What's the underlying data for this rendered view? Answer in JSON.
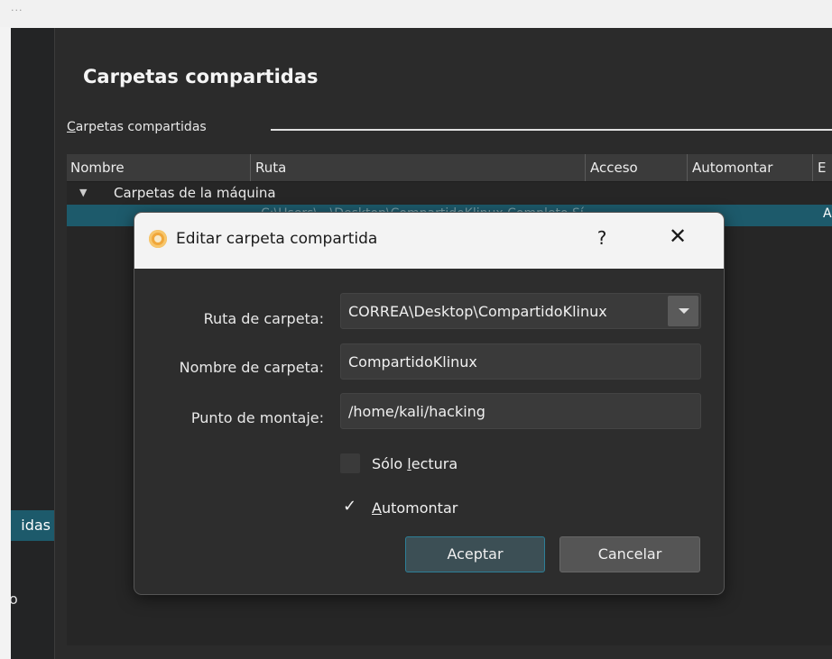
{
  "top_strip": {
    "glyph": "..."
  },
  "sidebar": {
    "items": [
      {
        "label": "idas",
        "active": true
      },
      {
        "label": "o",
        "active": false
      }
    ]
  },
  "page": {
    "title": "Carpetas compartidas",
    "group_label_accel": "C",
    "group_label_rest": "arpetas compartidas"
  },
  "table": {
    "columns": [
      "Nombre",
      "Ruta",
      "Acceso",
      "Automontar",
      "E"
    ],
    "tree_group": "Carpetas de la máquina",
    "selected_row_ghost": "C:\\Users\\...\\Desktop\\CompartidoKlinux   Completo   Sí",
    "selected_row_tail": "A"
  },
  "dialog": {
    "title": "Editar carpeta compartida",
    "help_glyph": "?",
    "close_glyph": "✕",
    "fields": {
      "path_label": "Ruta de carpeta:",
      "path_value": "CORREA\\Desktop\\CompartidoKlinux",
      "name_label": "Nombre de carpeta:",
      "name_value": "CompartidoKlinux",
      "mount_label": "Punto de montaje:",
      "mount_value": "/home/kali/hacking"
    },
    "readonly": {
      "label_pre": "Sólo ",
      "label_accel": "l",
      "label_post": "ectura",
      "checked": false
    },
    "automount": {
      "label_accel": "A",
      "label_post": "utomontar",
      "checked": true,
      "mark": "✓"
    },
    "buttons": {
      "accept": "Aceptar",
      "cancel": "Cancelar"
    }
  },
  "colors": {
    "selection": "#1d5a6b",
    "panel": "#2b2b2b",
    "dialog_title_bg": "#f3f3f3",
    "primary_border": "#2d7f97"
  }
}
